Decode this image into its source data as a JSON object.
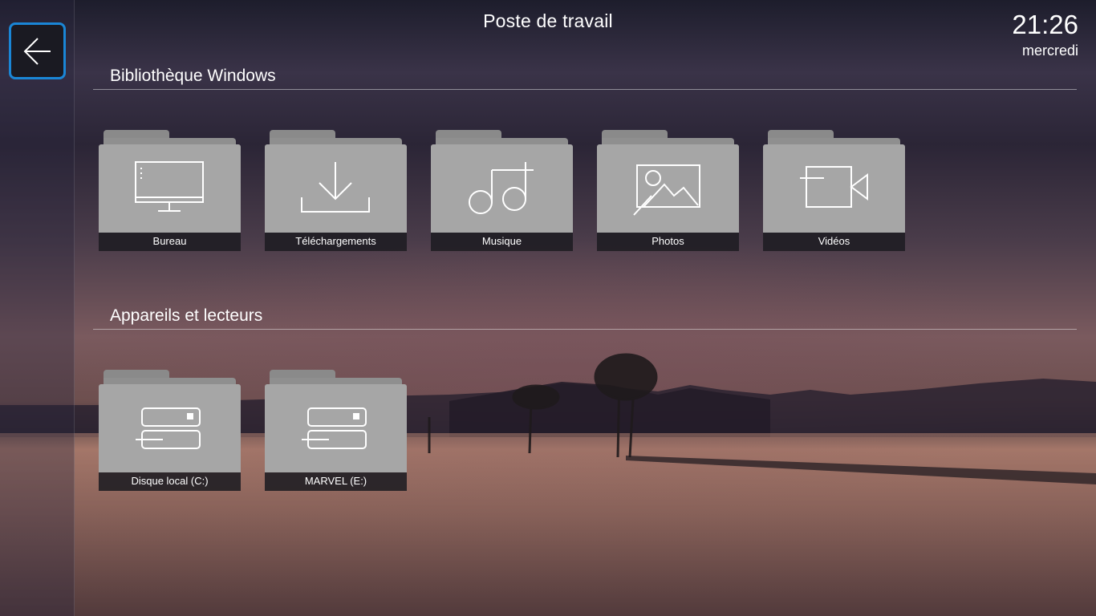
{
  "window": {
    "title": "Poste de travail"
  },
  "clock": {
    "time": "21:26",
    "day": "mercredi"
  },
  "sections": [
    {
      "heading": "Bibliothèque Windows",
      "items": [
        {
          "label": "Bureau",
          "icon": "monitor-icon"
        },
        {
          "label": "Téléchargements",
          "icon": "download-icon"
        },
        {
          "label": "Musique",
          "icon": "music-note-icon"
        },
        {
          "label": "Photos",
          "icon": "picture-icon"
        },
        {
          "label": "Vidéos",
          "icon": "video-camera-icon"
        }
      ]
    },
    {
      "heading": "Appareils et lecteurs",
      "items": [
        {
          "label": "Disque local (C:)",
          "icon": "hard-drive-icon"
        },
        {
          "label": "MARVEL (E:)",
          "icon": "hard-drive-icon"
        }
      ]
    }
  ],
  "colors": {
    "accent": "#1a86d6",
    "tile": "#a6a6a6",
    "tile_label_bg": "#1e1c22"
  }
}
